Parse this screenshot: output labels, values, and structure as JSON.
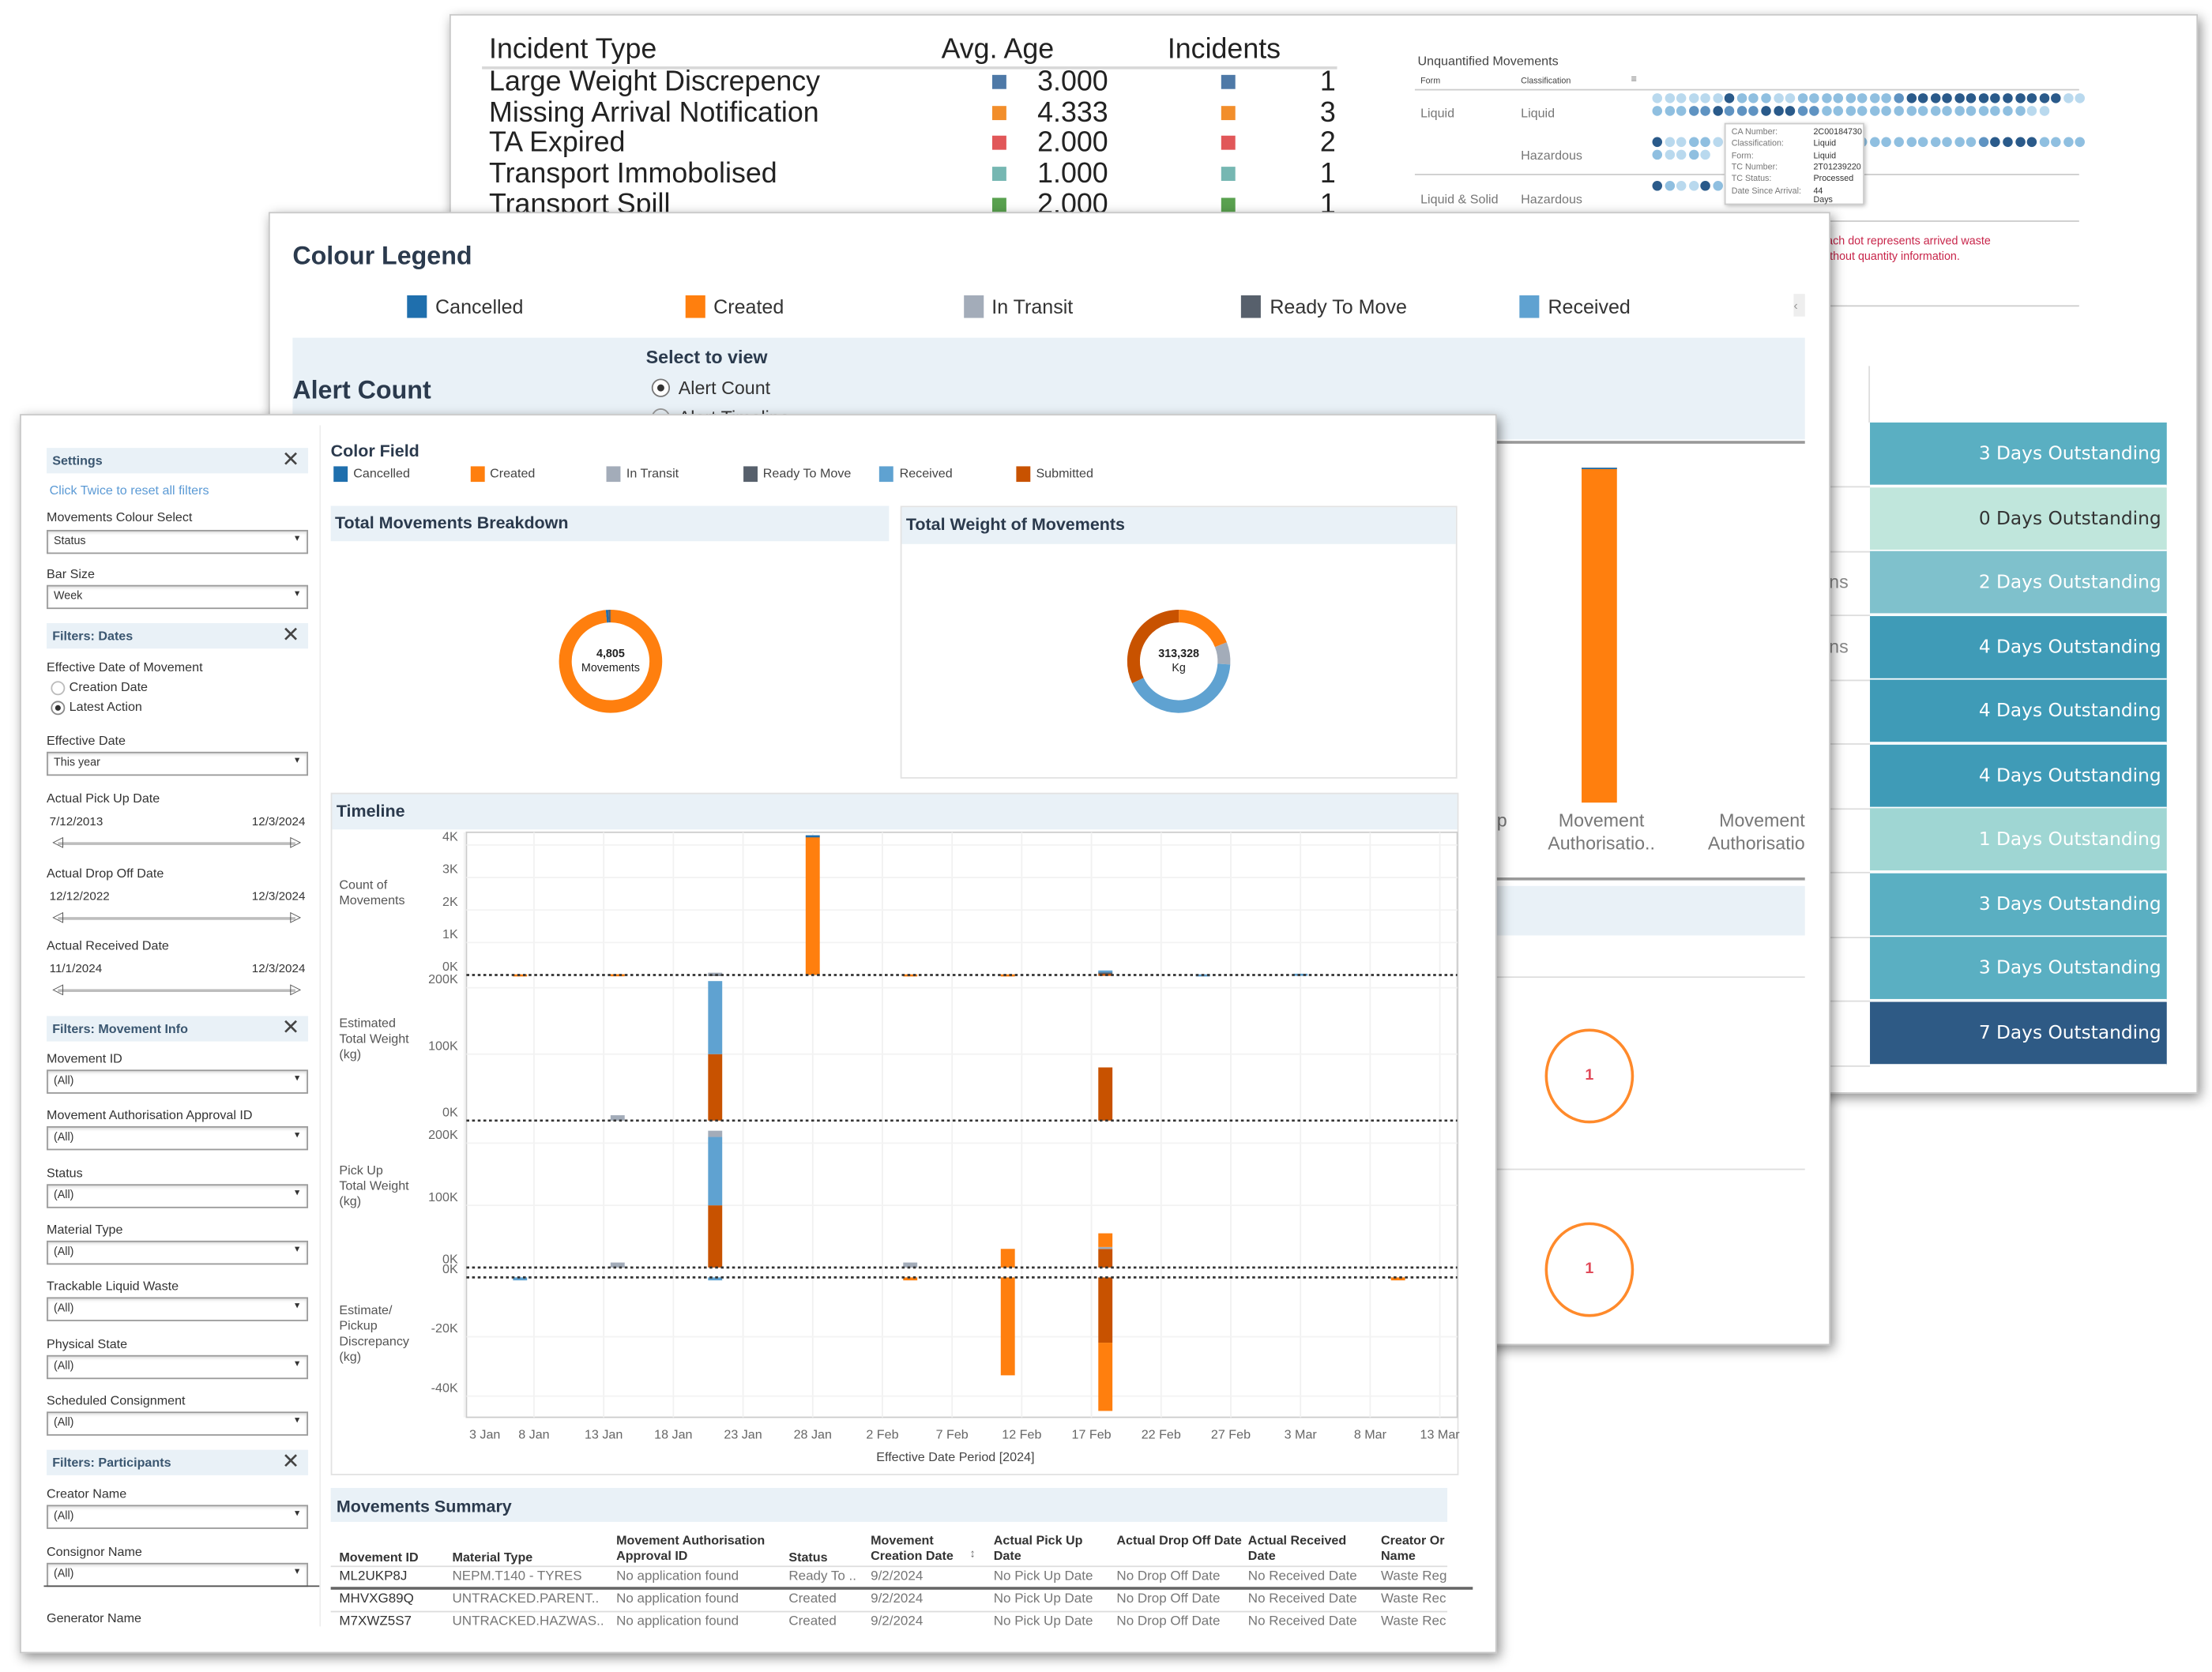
{
  "status_colors": {
    "Cancelled": "#1f6fad",
    "Created": "#ff7f0e",
    "In Transit": "#a3acb9",
    "Ready To Move": "#57606c",
    "Received": "#5fa2d1",
    "Submitted": "#c85200"
  },
  "incident_panel": {
    "headers": {
      "type": "Incident Type",
      "avg_age": "Avg. Age",
      "incidents": "Incidents"
    },
    "rows": [
      {
        "type": "Large Weight Discrepency",
        "avg_age": "3.000",
        "incidents": "1",
        "color": "#4e79a7"
      },
      {
        "type": "Missing Arrival Notification",
        "avg_age": "4.333",
        "incidents": "3",
        "color": "#f28e2b"
      },
      {
        "type": "TA Expired",
        "avg_age": "2.000",
        "incidents": "2",
        "color": "#e15759"
      },
      {
        "type": "Transport Immobolised",
        "avg_age": "1.000",
        "incidents": "1",
        "color": "#76b7b2"
      },
      {
        "type": "Transport Spill",
        "avg_age": "2.000",
        "incidents": "1",
        "color": "#59a14f"
      }
    ]
  },
  "unquantified": {
    "title": "Unquantified Movements",
    "headers": {
      "form": "Form",
      "classification": "Classification"
    },
    "dot_colors": {
      "1": "#b9d9ee",
      "2": "#8fbfe0",
      "3": "#5f93c2",
      "4": "#2a5a8a"
    },
    "rows": [
      {
        "form": "Liquid",
        "classification": "Liquid",
        "dots": [
          "111111422211222222223444444444444411",
          "222334333444332222222222222222211"
        ]
      },
      {
        "form": "",
        "classification": "Hazardous",
        "dots": [
          "411221222222222222222222222344442222",
          "21121"
        ]
      },
      {
        "form": "Liquid & Solid",
        "classification": "Hazardous",
        "dots": [
          "4211421"
        ]
      }
    ],
    "tooltip": [
      {
        "k": "CA Number:",
        "v": "2C00184730"
      },
      {
        "k": "Classification:",
        "v": "Liquid"
      },
      {
        "k": "Form:",
        "v": "Liquid"
      },
      {
        "k": "TC Number:",
        "v": "2T01239220"
      },
      {
        "k": "TC Status:",
        "v": "Processed"
      },
      {
        "k": "Date Since Arrival:",
        "v": "44 Days"
      }
    ],
    "note_line1": "Each dot represents arrived waste",
    "note_line2": "without quantity information."
  },
  "days_outstanding": {
    "partial_labels": [
      "ns",
      "ns"
    ],
    "rows": [
      {
        "label": "3 Days Outstanding",
        "days": 3
      },
      {
        "label": "0 Days Outstanding",
        "days": 0
      },
      {
        "label": "2 Days Outstanding",
        "days": 2
      },
      {
        "label": "4 Days Outstanding",
        "days": 4
      },
      {
        "label": "4 Days Outstanding",
        "days": 4
      },
      {
        "label": "4 Days Outstanding",
        "days": 4
      },
      {
        "label": "1 Days Outstanding",
        "days": 1
      },
      {
        "label": "3 Days Outstanding",
        "days": 3
      },
      {
        "label": "3 Days Outstanding",
        "days": 3
      },
      {
        "label": "7 Days Outstanding",
        "days": 7
      }
    ],
    "colors": {
      "0": "#c0e6dc",
      "1": "#9fd6d3",
      "2": "#7fc1cc",
      "3": "#5aafc2",
      "4": "#3f9bb7",
      "7": "#2e5a85"
    }
  },
  "legend_panel": {
    "title": "Colour Legend",
    "items": [
      "Cancelled",
      "Created",
      "In Transit",
      "Ready To Move",
      "Received"
    ],
    "alert_title": "Alert Count",
    "select_label": "Select to view",
    "options": [
      "Alert Count",
      "Alert Timeline"
    ],
    "selected_option": "Alert Count",
    "bar_labels": [
      "p",
      "Movement Authorisatio..",
      "Movement Authorisatio"
    ],
    "circle_values": [
      "1",
      "1"
    ]
  },
  "sidebar": {
    "settings": {
      "title": "Settings",
      "reset_link": "Click Twice to reset all filters",
      "colour_select": {
        "label": "Movements Colour Select",
        "value": "Status"
      },
      "bar_size": {
        "label": "Bar Size",
        "value": "Week"
      }
    },
    "dates": {
      "title": "Filters: Dates",
      "effective_label": "Effective Date of Movement",
      "radios": [
        "Creation Date",
        "Latest Action"
      ],
      "selected": "Latest Action",
      "effective_date": {
        "label": "Effective Date",
        "value": "This year"
      },
      "ranges": [
        {
          "label": "Actual Pick Up Date",
          "from": "7/12/2013",
          "to": "12/3/2024"
        },
        {
          "label": "Actual Drop Off Date",
          "from": "12/12/2022",
          "to": "12/3/2024"
        },
        {
          "label": "Actual Received Date",
          "from": "11/1/2024",
          "to": "12/3/2024"
        }
      ]
    },
    "movement_info": {
      "title": "Filters: Movement Info",
      "filters": [
        {
          "label": "Movement ID",
          "value": "(All)"
        },
        {
          "label": "Movement Authorisation Approval ID",
          "value": "(All)"
        },
        {
          "label": "Status",
          "value": "(All)"
        },
        {
          "label": "Material Type",
          "value": "(All)"
        },
        {
          "label": "Trackable Liquid Waste",
          "value": "(All)"
        },
        {
          "label": "Physical State",
          "value": "(All)"
        },
        {
          "label": "Scheduled Consignment",
          "value": "(All)"
        }
      ]
    },
    "participants": {
      "title": "Filters: Participants",
      "filters": [
        {
          "label": "Creator Name",
          "value": "(All)"
        },
        {
          "label": "Consignor Name",
          "value": "(All)"
        }
      ],
      "next_label": "Generator Name"
    }
  },
  "main": {
    "color_field_title": "Color Field",
    "legend": [
      "Cancelled",
      "Created",
      "In Transit",
      "Ready To Move",
      "Received",
      "Submitted"
    ],
    "movements_panel": {
      "title": "Total Movements Breakdown",
      "value": "4,805",
      "unit": "Movements"
    },
    "weight_panel": {
      "title": "Total Weight of Movements",
      "value": "313,328",
      "unit": "Kg"
    },
    "summary": {
      "title": "Movements Summary",
      "columns": [
        "Movement ID",
        "Material Type",
        "Movement Authorisation Approval ID",
        "Status",
        "Movement Creation Date",
        "Actual Pick Up Date",
        "Actual Drop Off Date",
        "Actual Received Date",
        "Creator Or Name"
      ],
      "rows": [
        [
          "ML2UKP8J",
          "NEPM.T140 - TYRES",
          "No application found",
          "Ready To ..",
          "9/2/2024",
          "No Pick Up Date",
          "No Drop Off Date",
          "No Received Date",
          "Waste Reg"
        ],
        [
          "MHVXG89Q",
          "UNTRACKED.PARENT..",
          "No application found",
          "Created",
          "9/2/2024",
          "No Pick Up Date",
          "No Drop Off Date",
          "No Received Date",
          "Waste Rec"
        ],
        [
          "M7XWZ5S7",
          "UNTRACKED.HAZWAS..",
          "No application found",
          "Created",
          "9/2/2024",
          "No Pick Up Date",
          "No Drop Off Date",
          "No Received Date",
          "Waste Rec"
        ]
      ]
    }
  },
  "chart_data": [
    {
      "type": "pie",
      "title": "Total Movements Breakdown",
      "center_label": "4,805 Movements",
      "donut": true,
      "slices": [
        {
          "status": "Created",
          "share": 0.985
        },
        {
          "status": "Cancelled",
          "share": 0.008
        },
        {
          "status": "Ready To Move",
          "share": 0.007
        }
      ]
    },
    {
      "type": "pie",
      "title": "Total Weight of Movements",
      "center_label": "313,328 Kg",
      "donut": true,
      "slices": [
        {
          "status": "Created",
          "share": 0.19
        },
        {
          "status": "In Transit",
          "share": 0.07
        },
        {
          "status": "Received",
          "share": 0.42
        },
        {
          "status": "Submitted",
          "share": 0.32
        }
      ]
    },
    {
      "type": "bar",
      "title": "Timeline",
      "stacked": true,
      "xlabel": "Effective Date Period [2024]",
      "x_ticks": [
        "3 Jan",
        "8 Jan",
        "13 Jan",
        "18 Jan",
        "23 Jan",
        "28 Jan",
        "2 Feb",
        "7 Feb",
        "12 Feb",
        "17 Feb",
        "22 Feb",
        "27 Feb",
        "3 Mar",
        "8 Mar",
        "13 Mar"
      ],
      "panes": [
        {
          "ylabel": "Count of Movements",
          "ticks": [
            {
              "v": 0,
              "t": "0K"
            },
            {
              "v": 1000,
              "t": "1K"
            },
            {
              "v": 2000,
              "t": "2K"
            },
            {
              "v": 3000,
              "t": "3K"
            },
            {
              "v": 4000,
              "t": "4K"
            }
          ],
          "bars": [
            {
              "week": "2024-01-07",
              "segments": [
                [
                  "Created",
                  20
                ]
              ]
            },
            {
              "week": "2024-01-14",
              "segments": [
                [
                  "Created",
                  25
                ]
              ]
            },
            {
              "week": "2024-01-21",
              "segments": [
                [
                  "Ready To Move",
                  40
                ],
                [
                  "In Transit",
                  30
                ]
              ]
            },
            {
              "week": "2024-01-28",
              "segments": [
                [
                  "Created",
                  4250
                ],
                [
                  "Cancelled",
                  50
                ]
              ]
            },
            {
              "week": "2024-02-04",
              "segments": [
                [
                  "Created",
                  20
                ]
              ]
            },
            {
              "week": "2024-02-11",
              "segments": [
                [
                  "Created",
                  20
                ]
              ]
            },
            {
              "week": "2024-02-18",
              "segments": [
                [
                  "Submitted",
                  40
                ],
                [
                  "Ready To Move",
                  60
                ],
                [
                  "Received",
                  40
                ]
              ]
            },
            {
              "week": "2024-02-25",
              "segments": [
                [
                  "Received",
                  20
                ]
              ]
            },
            {
              "week": "2024-03-03",
              "segments": [
                [
                  "Received",
                  40
                ]
              ]
            }
          ]
        },
        {
          "ylabel": "Estimated Total Weight (kg)",
          "ticks": [
            {
              "v": 0,
              "t": "0K"
            },
            {
              "v": 100000,
              "t": "100K"
            },
            {
              "v": 200000,
              "t": "200K"
            }
          ],
          "bars": [
            {
              "week": "2024-01-14",
              "segments": [
                [
                  "In Transit",
                  8000
                ]
              ]
            },
            {
              "week": "2024-01-21",
              "segments": [
                [
                  "Submitted",
                  100000
                ],
                [
                  "Received",
                  110000
                ]
              ]
            },
            {
              "week": "2024-02-18",
              "segments": [
                [
                  "Submitted",
                  80000
                ]
              ]
            }
          ]
        },
        {
          "ylabel": "Pick Up Total Weight (kg)",
          "ticks": [
            {
              "v": 0,
              "t": "0K"
            },
            {
              "v": 100000,
              "t": "100K"
            },
            {
              "v": 200000,
              "t": "200K"
            }
          ],
          "bars": [
            {
              "week": "2024-01-14",
              "segments": [
                [
                  "In Transit",
                  8000
                ]
              ]
            },
            {
              "week": "2024-01-21",
              "segments": [
                [
                  "Submitted",
                  100000
                ],
                [
                  "Received",
                  110000
                ],
                [
                  "In Transit",
                  10000
                ]
              ]
            },
            {
              "week": "2024-02-04",
              "segments": [
                [
                  "In Transit",
                  8000
                ]
              ]
            },
            {
              "week": "2024-02-11",
              "segments": [
                [
                  "Created",
                  30000
                ]
              ]
            },
            {
              "week": "2024-02-18",
              "segments": [
                [
                  "Submitted",
                  30000
                ],
                [
                  "In Transit",
                  3000
                ],
                [
                  "Created",
                  22000
                ]
              ]
            }
          ]
        },
        {
          "ylabel": "Estimate/ Pickup Discrepancy (kg)",
          "ticks": [
            {
              "v": 0,
              "t": "0K"
            },
            {
              "v": -20000,
              "t": "-20K"
            },
            {
              "v": -40000,
              "t": "-40K"
            }
          ],
          "bars": [
            {
              "week": "2024-01-07",
              "segments": [
                [
                  "Received",
                  -1000
                ]
              ]
            },
            {
              "week": "2024-01-21",
              "segments": [
                [
                  "Received",
                  -1000
                ]
              ]
            },
            {
              "week": "2024-02-04",
              "segments": [
                [
                  "Created",
                  -1000
                ]
              ]
            },
            {
              "week": "2024-02-11",
              "segments": [
                [
                  "Created",
                  -33000
                ]
              ]
            },
            {
              "week": "2024-02-18",
              "segments": [
                [
                  "Submitted",
                  -22000
                ],
                [
                  "Created",
                  -23000
                ]
              ]
            },
            {
              "week": "2024-03-10",
              "segments": [
                [
                  "Created",
                  -1000
                ]
              ]
            }
          ]
        }
      ]
    },
    {
      "type": "bar",
      "title": "Alert Count",
      "categories": [
        "Movement Authorisatio..",
        "Movement Authorisatio"
      ],
      "segments": [
        [
          "Created",
          0.99
        ],
        [
          "Cancelled",
          0.01
        ]
      ]
    }
  ]
}
